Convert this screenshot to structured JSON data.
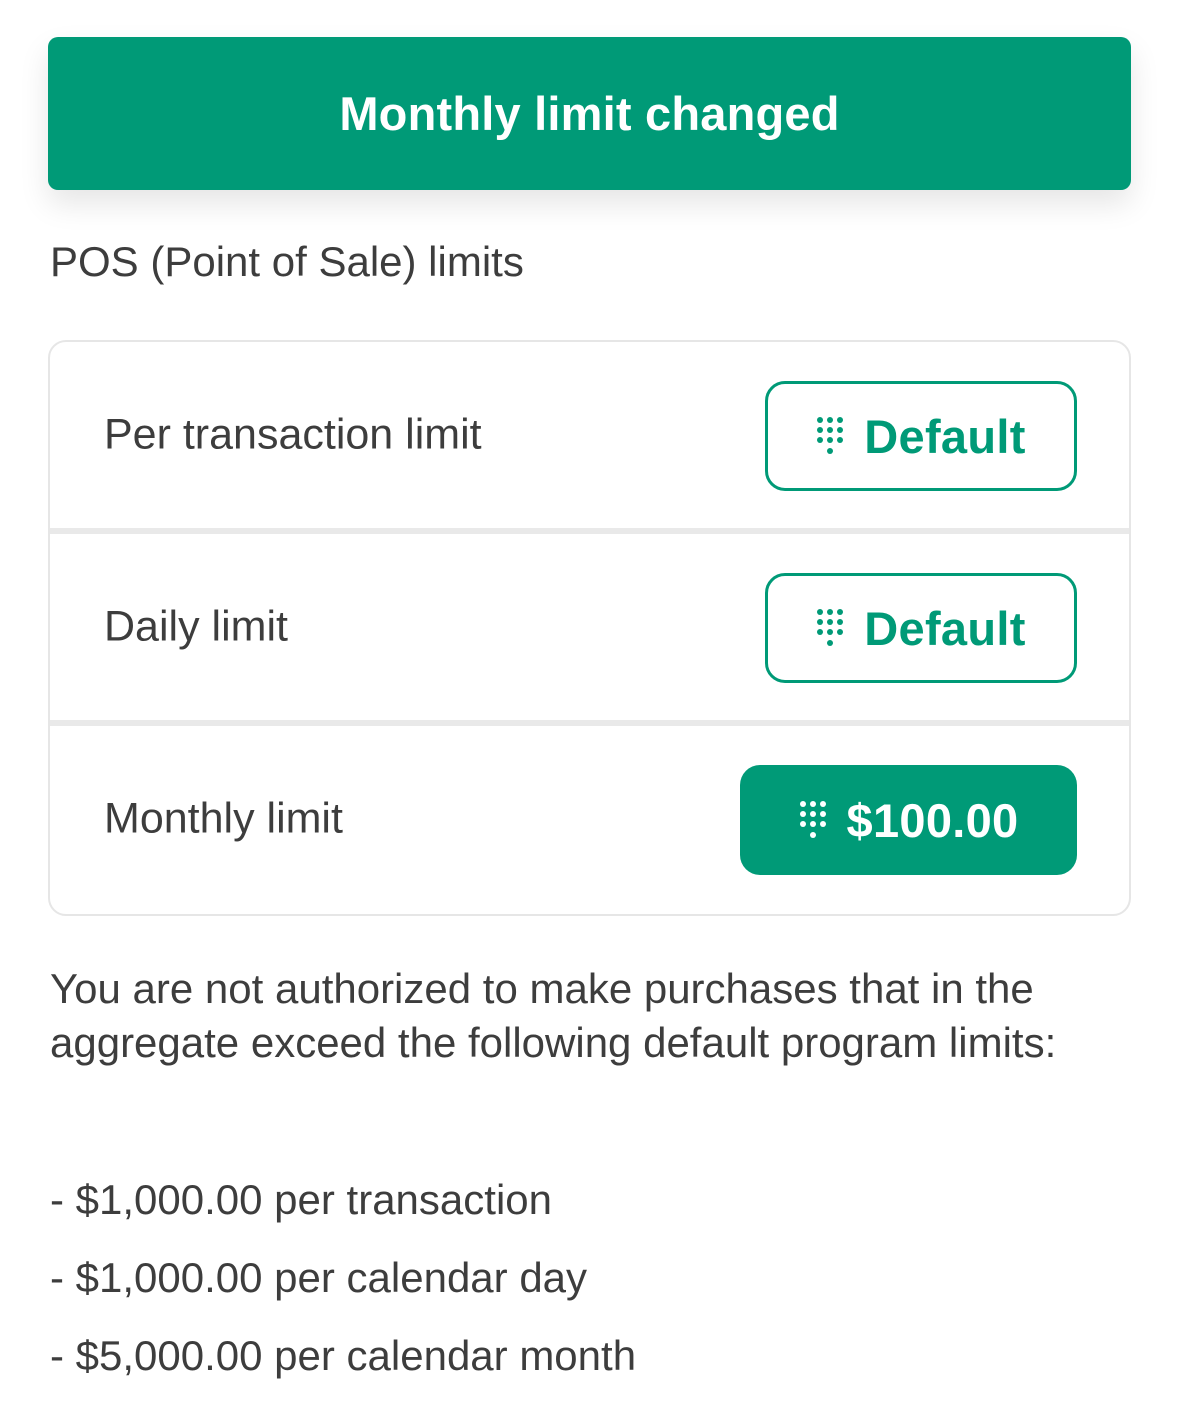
{
  "toast": {
    "message": "Monthly limit changed"
  },
  "section": {
    "title": "POS (Point of Sale) limits"
  },
  "limits": [
    {
      "label": "Per transaction limit",
      "value": "Default",
      "style": "outline",
      "icon": "keypad-icon"
    },
    {
      "label": "Daily limit",
      "value": "Default",
      "style": "outline",
      "icon": "keypad-icon"
    },
    {
      "label": "Monthly limit",
      "value": "$100.00",
      "style": "filled",
      "icon": "keypad-icon"
    }
  ],
  "disclaimer": {
    "text": "You are not authorized to make purchases that in the aggregate exceed the following default program limits:",
    "items": [
      "- $1,000.00 per transaction",
      "- $1,000.00 per calendar day",
      "- $5,000.00 per calendar month"
    ]
  },
  "colors": {
    "accent": "#009a77",
    "text": "#3d3d3d",
    "border": "#e6e6e6",
    "background": "#ffffff"
  }
}
